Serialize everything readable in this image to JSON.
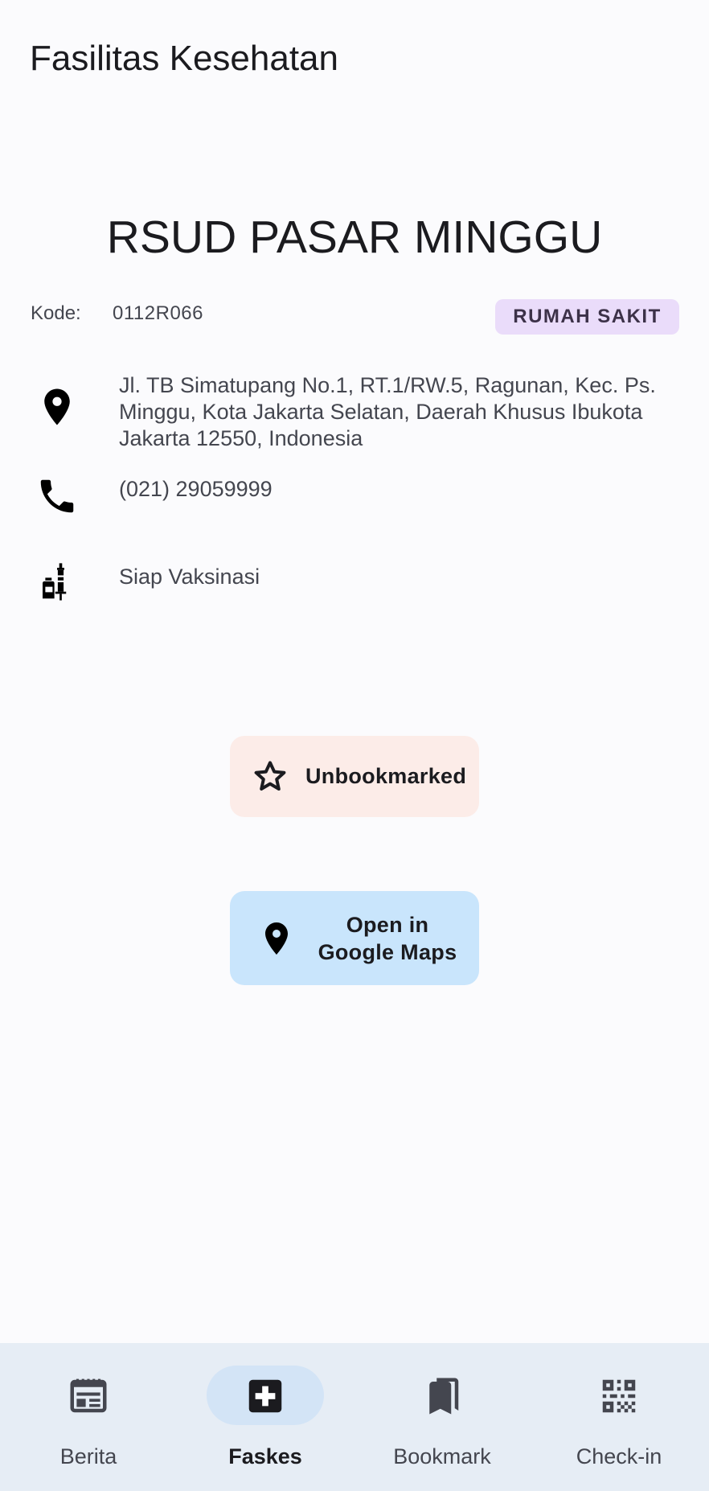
{
  "app_bar": {
    "title": "Fasilitas Kesehatan"
  },
  "facility": {
    "name": "RSUD PASAR MINGGU",
    "code_label": "Kode:",
    "code": "0112R066",
    "type": "RUMAH SAKIT",
    "address": "Jl. TB Simatupang No.1, RT.1/RW.5, Ragunan, Kec. Ps. Minggu, Kota Jakarta Selatan, Daerah Khusus Ibukota Jakarta 12550, Indonesia",
    "phone": "(021) 29059999",
    "vaccination_status": "Siap Vaksinasi"
  },
  "actions": {
    "bookmark_label": "Unbookmarked",
    "maps_label_line1": "Open in",
    "maps_label_line2": "Google Maps"
  },
  "icons": {
    "address": "location-pin-icon",
    "phone": "phone-icon",
    "vaccine": "vaccine-icon",
    "bookmark": "star-outline-icon",
    "maps": "location-pin-icon"
  },
  "bottom_nav": {
    "active_index": 1,
    "items": [
      {
        "label": "Berita",
        "icon": "newspaper-icon"
      },
      {
        "label": "Faskes",
        "icon": "medical-cross-icon"
      },
      {
        "label": "Bookmark",
        "icon": "bookmarks-icon"
      },
      {
        "label": "Check-in",
        "icon": "qr-code-icon"
      }
    ]
  },
  "colors": {
    "background": "#fbfbfd",
    "chip": "#eadcfa",
    "bookmark_button": "#fcece8",
    "maps_button": "#c9e5fc",
    "nav_background": "#e6edf5",
    "nav_active_pill": "#d3e4f6"
  }
}
